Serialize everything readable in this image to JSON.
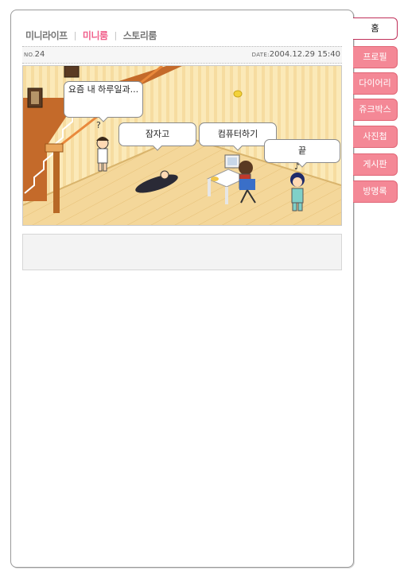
{
  "subnav": {
    "items": [
      {
        "label": "미니라이프",
        "active": false
      },
      {
        "label": "미니룸",
        "active": true
      },
      {
        "label": "스토리룸",
        "active": false
      }
    ],
    "separator": "|"
  },
  "post": {
    "no_label": "NO.",
    "no_value": "24",
    "date_label": "DATE:",
    "date_value": "2004.12.29 15:40"
  },
  "room": {
    "bubbles": [
      {
        "text": "요즘 내 하루일과..."
      },
      {
        "text": "잠자고"
      },
      {
        "text": "컴퓨터하기"
      },
      {
        "text": "끝"
      }
    ],
    "colors": {
      "floor": "#f4d79a",
      "wall": "#fbe9b8",
      "stairs": "#e9893c"
    }
  },
  "tabs": [
    {
      "label": "홈",
      "active": true
    },
    {
      "label": "프로필",
      "active": false
    },
    {
      "label": "다이어리",
      "active": false
    },
    {
      "label": "쥬크박스",
      "active": false
    },
    {
      "label": "사진첩",
      "active": false
    },
    {
      "label": "게시판",
      "active": false
    },
    {
      "label": "방명록",
      "active": false
    }
  ],
  "colors": {
    "accent": "#f0608c",
    "tab": "#f48896"
  }
}
